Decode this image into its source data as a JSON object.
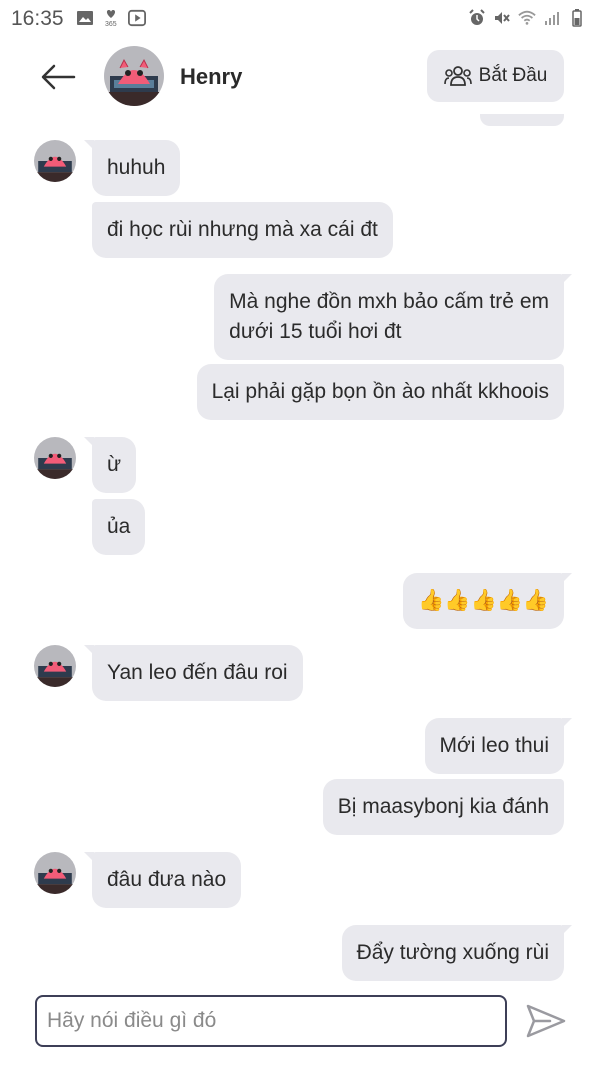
{
  "status_bar": {
    "time": "16:35",
    "left_icons": [
      "image-icon",
      "heart-365-icon",
      "play-icon"
    ],
    "right_icons": [
      "alarm-icon",
      "mute-icon",
      "wifi-icon",
      "signal-icon",
      "battery-icon"
    ]
  },
  "header": {
    "contact_name": "Henry",
    "start_button_label": "Bắt Đầu"
  },
  "messages": [
    {
      "side": "in",
      "text": "huhuh"
    },
    {
      "side": "in",
      "text": "đi học rùi nhưng mà xa cái đt"
    },
    {
      "side": "out",
      "text": "Mà nghe đồn mxh bảo cấm trẻ em\ndưới 15 tuổi hơi đt"
    },
    {
      "side": "out",
      "text": "Lại phải gặp bọn ồn ào nhất kkhoois"
    },
    {
      "side": "in",
      "text": "ừ"
    },
    {
      "side": "in",
      "text": "ủa"
    },
    {
      "side": "out",
      "text": "👍👍👍👍👍"
    },
    {
      "side": "in",
      "text": "Yan leo đến đâu roi"
    },
    {
      "side": "out",
      "text": "Mới leo thui"
    },
    {
      "side": "out",
      "text": "Bị maasybonj kia đánh"
    },
    {
      "side": "in",
      "text": "đâu đưa nào"
    },
    {
      "side": "out",
      "text": "Đẩy tường xuống rùi"
    }
  ],
  "composer": {
    "placeholder": "Hãy nói điều gì đó",
    "value": ""
  },
  "colors": {
    "bubble": "#e9e9ee",
    "input_border": "#3d3f57",
    "send_icon": "#9a9aa0"
  }
}
